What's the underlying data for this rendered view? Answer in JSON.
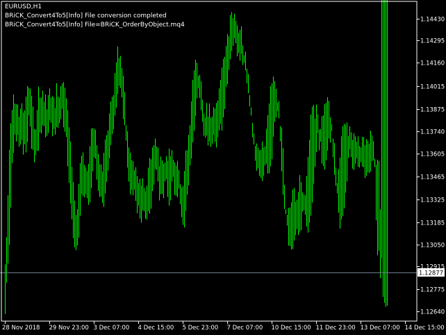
{
  "chart_header": {
    "symbol_timeframe": "EURUSD,H1",
    "log_line_1": "BRiCK_Convert4To5[Info] File conversion completed",
    "log_line_2": "BRiCK_Convert4To5[Info] File=BRiCK_OrderByObject.mq4"
  },
  "colors": {
    "background": "#000000",
    "bars": "#00ff00",
    "frame": "#ffffff",
    "bid_line": "#708090",
    "price_label_bg": "#ffffff",
    "price_label_text": "#000000"
  },
  "chart_data": {
    "type": "bar",
    "symbol": "EURUSD",
    "timeframe": "H1",
    "current_price_label": "1.12877",
    "current_price": 1.12877,
    "y_ticks": [
      "1.14430",
      "1.14295",
      "1.14160",
      "1.14015",
      "1.13875",
      "1.13740",
      "1.13605",
      "1.13465",
      "1.13325",
      "1.13185",
      "1.13050",
      "1.12915",
      "1.12775",
      "1.12640"
    ],
    "y_tick_values": [
      1.1443,
      1.14295,
      1.1416,
      1.14015,
      1.13875,
      1.1374,
      1.13605,
      1.13465,
      1.13325,
      1.13185,
      1.1305,
      1.12915,
      1.12775,
      1.1264
    ],
    "x_ticks": [
      "28 Nov 2018",
      "29 Nov 23:00",
      "3 Dec 07:00",
      "4 Dec 15:00",
      "5 Dec 23:00",
      "7 Dec 07:00",
      "10 Dec 15:00",
      "11 Dec 23:00",
      "13 Dec 07:00",
      "14 Dec 15:00"
    ],
    "x_tick_bar_index": [
      0,
      32,
      64,
      96,
      128,
      160,
      192,
      224,
      256,
      288
    ],
    "ylim": [
      1.12585,
      1.1453
    ],
    "bar_count": 290,
    "closes": [
      1.12721,
      1.12853,
      1.12951,
      1.13133,
      1.13347,
      1.13583,
      1.13695,
      1.13826,
      1.13865,
      1.13764,
      1.13763,
      1.13806,
      1.13761,
      1.13771,
      1.13726,
      1.13687,
      1.13848,
      1.13951,
      1.13924,
      1.13807,
      1.13733,
      1.13675,
      1.13652,
      1.13689,
      1.1377,
      1.13839,
      1.13885,
      1.13889,
      1.13834,
      1.13808,
      1.13777,
      1.1383,
      1.13902,
      1.13908,
      1.13853,
      1.13807,
      1.13816,
      1.13838,
      1.13844,
      1.13872,
      1.1392,
      1.13924,
      1.13894,
      1.13871,
      1.13809,
      1.13691,
      1.13568,
      1.13458,
      1.13345,
      1.13247,
      1.13148,
      1.13123,
      1.13138,
      1.13217,
      1.13326,
      1.1343,
      1.13458,
      1.13434,
      1.13407,
      1.13393,
      1.13394,
      1.13388,
      1.13456,
      1.13569,
      1.13649,
      1.13642,
      1.13578,
      1.13524,
      1.13463,
      1.13421,
      1.13408,
      1.13404,
      1.13422,
      1.13475,
      1.1355,
      1.13613,
      1.13694,
      1.13787,
      1.13845,
      1.13891,
      1.13961,
      1.14031,
      1.14081,
      1.14105,
      1.14057,
      1.13992,
      1.13889,
      1.13739,
      1.13613,
      1.13535,
      1.13466,
      1.13417,
      1.13441,
      1.13455,
      1.13405,
      1.13366,
      1.1336,
      1.13338,
      1.13312,
      1.13323,
      1.13328,
      1.13304,
      1.13286,
      1.1329,
      1.13323,
      1.13364,
      1.13441,
      1.13525,
      1.13578,
      1.13594,
      1.13508,
      1.13455,
      1.13415,
      1.13399,
      1.13467,
      1.1353,
      1.13504,
      1.13446,
      1.13399,
      1.13419,
      1.13522,
      1.13542,
      1.13451,
      1.13392,
      1.13441,
      1.13443,
      1.13369,
      1.13297,
      1.13271,
      1.13281,
      1.13348,
      1.13459,
      1.13527,
      1.13591,
      1.1367,
      1.13742,
      1.1384,
      1.13959,
      1.1403,
      1.14055,
      1.14049,
      1.13974,
      1.13865,
      1.13789,
      1.13759,
      1.13759,
      1.13756,
      1.13749,
      1.13753,
      1.13776,
      1.13795,
      1.13794,
      1.13757,
      1.13783,
      1.13845,
      1.13859,
      1.13861,
      1.13932,
      1.14033,
      1.14091,
      1.14147,
      1.14207,
      1.14243,
      1.14307,
      1.14358,
      1.14348,
      1.14337,
      1.1432,
      1.14269,
      1.1425,
      1.14286,
      1.14294,
      1.14232,
      1.14171,
      1.14126,
      1.14086,
      1.14025,
      1.13959,
      1.13856,
      1.13799,
      1.13727,
      1.13624,
      1.13586,
      1.13579,
      1.13556,
      1.13545,
      1.13561,
      1.13602,
      1.13599,
      1.13568,
      1.13574,
      1.13585,
      1.13656,
      1.1378,
      1.13858,
      1.13894,
      1.13978,
      1.13995,
      1.13911,
      1.13839,
      1.13706,
      1.13554,
      1.13424,
      1.13286,
      1.13159,
      1.13079,
      1.13127,
      1.13153,
      1.13146,
      1.13173,
      1.1323,
      1.13253,
      1.13241,
      1.13231,
      1.13258,
      1.13333,
      1.13361,
      1.13336,
      1.13279,
      1.13213,
      1.13269,
      1.1333,
      1.13434,
      1.13524,
      1.13649,
      1.13763,
      1.13799,
      1.13755,
      1.13753,
      1.13721,
      1.13648,
      1.13624,
      1.13664,
      1.13712,
      1.13744,
      1.13796,
      1.13854,
      1.13856,
      1.13754,
      1.13651,
      1.13532,
      1.13382,
      1.13308,
      1.13311,
      1.13331,
      1.13396,
      1.13471,
      1.13531,
      1.13634,
      1.13699,
      1.13691,
      1.13676,
      1.13635,
      1.13631,
      1.13669,
      1.13637,
      1.13605,
      1.13631,
      1.13633,
      1.13603,
      1.13563,
      1.13563,
      1.13596,
      1.13582,
      1.13585,
      1.13607,
      1.13625,
      1.13622,
      1.13626,
      1.13666,
      1.13604,
      1.13387,
      1.1309,
      1.12886,
      1.12806,
      1.12755,
      1.12713
    ],
    "highs": [
      1.12928,
      1.13095,
      1.1335,
      1.13628,
      1.1379,
      1.13871,
      1.13966,
      1.1391,
      1.13906,
      1.13905,
      1.13829,
      1.13879,
      1.13912,
      1.13855,
      1.13868,
      1.13953,
      1.14017,
      1.14009,
      1.14,
      1.13957,
      1.13892,
      1.13755,
      1.13752,
      1.13871,
      1.14014,
      1.13946,
      1.13947,
      1.13989,
      1.13921,
      1.13966,
      1.13875,
      1.13962,
      1.14003,
      1.13946,
      1.13955,
      1.13946,
      1.13883,
      1.14034,
      1.13953,
      1.13947,
      1.14016,
      1.14032,
      1.14041,
      1.14007,
      1.13942,
      1.13871,
      1.13765,
      1.13678,
      1.13523,
      1.13431,
      1.13317,
      1.13229,
      1.13265,
      1.13419,
      1.13547,
      1.13591,
      1.13611,
      1.13536,
      1.13519,
      1.13497,
      1.13542,
      1.1365,
      1.13757,
      1.13761,
      1.13755,
      1.1375,
      1.13655,
      1.13603,
      1.13539,
      1.13537,
      1.13495,
      1.13609,
      1.13691,
      1.13717,
      1.13745,
      1.1385,
      1.13923,
      1.13951,
      1.13961,
      1.14096,
      1.14162,
      1.14259,
      1.14188,
      1.14201,
      1.14126,
      1.1408,
      1.13982,
      1.13778,
      1.13741,
      1.13641,
      1.13609,
      1.13565,
      1.13558,
      1.13504,
      1.13521,
      1.13467,
      1.13425,
      1.1345,
      1.1341,
      1.13454,
      1.13395,
      1.13373,
      1.13408,
      1.13519,
      1.13577,
      1.13569,
      1.13642,
      1.13655,
      1.13697,
      1.13649,
      1.1364,
      1.13527,
      1.13586,
      1.13562,
      1.13542,
      1.13549,
      1.13589,
      1.1356,
      1.13635,
      1.13589,
      1.13626,
      1.13567,
      1.13551,
      1.1353,
      1.1356,
      1.13505,
      1.13417,
      1.13397,
      1.13405,
      1.13498,
      1.13622,
      1.13626,
      1.13719,
      1.13778,
      1.13923,
      1.14055,
      1.14113,
      1.14178,
      1.14159,
      1.14079,
      1.14085,
      1.14046,
      1.13933,
      1.13847,
      1.13825,
      1.13914,
      1.1383,
      1.13911,
      1.13824,
      1.13831,
      1.13887,
      1.13879,
      1.13914,
      1.13928,
      1.14003,
      1.14054,
      1.1413,
      1.14184,
      1.14196,
      1.14262,
      1.14334,
      1.1432,
      1.14451,
      1.14468,
      1.14432,
      1.14459,
      1.14414,
      1.14388,
      1.14343,
      1.1436,
      1.14382,
      1.14266,
      1.14205,
      1.14226,
      1.14123,
      1.14091,
      1.13962,
      1.13886,
      1.13792,
      1.13726,
      1.13652,
      1.13666,
      1.1364,
      1.13625,
      1.13626,
      1.13678,
      1.1364,
      1.13649,
      1.13756,
      1.13839,
      1.13911,
      1.14016,
      1.14034,
      1.14075,
      1.14047,
      1.13999,
      1.13915,
      1.1382,
      1.13679,
      1.13496,
      1.13352,
      1.13265,
      1.13235,
      1.13231,
      1.13272,
      1.13275,
      1.13307,
      1.13385,
      1.13394,
      1.1331,
      1.13323,
      1.13371,
      1.13474,
      1.13429,
      1.13367,
      1.13355,
      1.13349,
      1.13467,
      1.13584,
      1.13689,
      1.13843,
      1.13891,
      1.13902,
      1.13817,
      1.13904,
      1.13844,
      1.13752,
      1.13754,
      1.13833,
      1.13839,
      1.13906,
      1.13915,
      1.13949,
      1.13927,
      1.13826,
      1.13741,
      1.13582,
      1.13474,
      1.13408,
      1.13425,
      1.13509,
      1.1358,
      1.13711,
      1.13772,
      1.13787,
      1.13781,
      1.13794,
      1.13712,
      1.13771,
      1.13734,
      1.13689,
      1.13729,
      1.1371,
      1.13677,
      1.1371,
      1.13651,
      1.13643,
      1.13706,
      1.13705,
      1.13656,
      1.13692,
      1.13682,
      1.13665,
      1.13744,
      1.13715,
      1.13681,
      1.13522,
      1.13196,
      1.12983,
      1.13011,
      1.12843
    ],
    "lows": [
      1.12624,
      1.12816,
      1.12932,
      1.13046,
      1.13274,
      1.13546,
      1.13608,
      1.13721,
      1.13679,
      1.13719,
      1.13646,
      1.13658,
      1.13688,
      1.13598,
      1.13661,
      1.13611,
      1.13674,
      1.13839,
      1.1377,
      1.13633,
      1.13627,
      1.13551,
      1.13596,
      1.13621,
      1.13621,
      1.13735,
      1.13727,
      1.13776,
      1.13772,
      1.13704,
      1.13712,
      1.1373,
      1.13809,
      1.13793,
      1.1371,
      1.13755,
      1.13721,
      1.13766,
      1.13761,
      1.1379,
      1.13815,
      1.13878,
      1.13764,
      1.13738,
      1.13705,
      1.13526,
      1.13426,
      1.13299,
      1.13203,
      1.13087,
      1.13032,
      1.13015,
      1.13043,
      1.13089,
      1.13225,
      1.13356,
      1.13346,
      1.13337,
      1.13358,
      1.13331,
      1.13291,
      1.13307,
      1.13393,
      1.13496,
      1.13581,
      1.13573,
      1.13445,
      1.13376,
      1.1334,
      1.13341,
      1.13302,
      1.13279,
      1.1336,
      1.13431,
      1.13502,
      1.13575,
      1.13655,
      1.13723,
      1.13751,
      1.13836,
      1.13885,
      1.13969,
      1.14019,
      1.14005,
      1.13948,
      1.13814,
      1.13777,
      1.13684,
      1.13519,
      1.13433,
      1.13354,
      1.13383,
      1.13349,
      1.13384,
      1.13315,
      1.13239,
      1.13287,
      1.13207,
      1.13182,
      1.13257,
      1.13252,
      1.13206,
      1.13201,
      1.13252,
      1.13238,
      1.13268,
      1.13375,
      1.13415,
      1.13509,
      1.13504,
      1.13434,
      1.13318,
      1.13356,
      1.13358,
      1.13332,
      1.13434,
      1.13447,
      1.1334,
      1.13287,
      1.13318,
      1.13434,
      1.13462,
      1.13351,
      1.13346,
      1.13338,
      1.1339,
      1.13294,
      1.13216,
      1.13169,
      1.13153,
      1.13254,
      1.13352,
      1.1341,
      1.13532,
      1.13573,
      1.13672,
      1.13743,
      1.13833,
      1.13942,
      1.14002,
      1.13945,
      1.13869,
      1.13798,
      1.13713,
      1.13702,
      1.13714,
      1.13654,
      1.13679,
      1.13646,
      1.13665,
      1.1372,
      1.13675,
      1.13641,
      1.13704,
      1.13746,
      1.13786,
      1.13744,
      1.13825,
      1.13876,
      1.14013,
      1.14029,
      1.14116,
      1.14181,
      1.14231,
      1.14263,
      1.14308,
      1.14278,
      1.14199,
      1.14219,
      1.14172,
      1.14213,
      1.14146,
      1.14159,
      1.14112,
      1.14034,
      1.13973,
      1.13892,
      1.13837,
      1.13704,
      1.1366,
      1.1356,
      1.135,
      1.13515,
      1.13468,
      1.13456,
      1.13437,
      1.13468,
      1.13533,
      1.13542,
      1.13482,
      1.13484,
      1.13526,
      1.1357,
      1.13707,
      1.13798,
      1.13825,
      1.13863,
      1.13925,
      1.13772,
      1.13763,
      1.13637,
      1.13413,
      1.13264,
      1.13164,
      1.13042,
      1.13039,
      1.13018,
      1.13021,
      1.13073,
      1.13105,
      1.13143,
      1.13106,
      1.13125,
      1.13136,
      1.13249,
      1.13258,
      1.13231,
      1.13157,
      1.13122,
      1.13181,
      1.13225,
      1.13305,
      1.13419,
      1.13524,
      1.13613,
      1.1373,
      1.13624,
      1.13677,
      1.13543,
      1.13528,
      1.13507,
      1.13563,
      1.13621,
      1.13697,
      1.13672,
      1.13784,
      1.13697,
      1.13669,
      1.13518,
      1.13361,
      1.13243,
      1.13146,
      1.13202,
      1.13221,
      1.1327,
      1.13365,
      1.13434,
      1.13578,
      1.13631,
      1.13583,
      1.13512,
      1.13504,
      1.13542,
      1.13575,
      1.13524,
      1.13519,
      1.13551,
      1.13525,
      1.1352,
      1.13455,
      1.13469,
      1.1349,
      1.13486,
      1.13494,
      1.13558,
      1.13563,
      1.13574,
      1.13536,
      1.13567,
      1.1356,
      1.13263,
      1.12967,
      1.12728,
      1.12692,
      1.12668,
      1.12676
    ]
  }
}
